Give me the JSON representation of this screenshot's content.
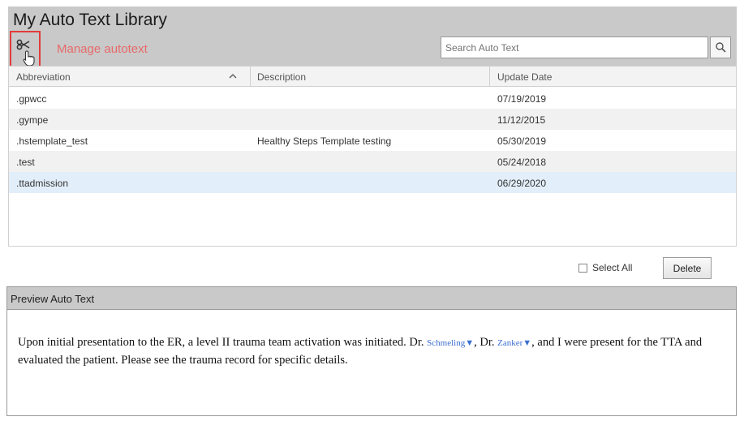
{
  "header": {
    "title": "My Auto Text Library",
    "manage_label": "Manage autotext",
    "search_placeholder": "Search Auto Text"
  },
  "table": {
    "columns": [
      "Abbreviation",
      "Description",
      "Update Date"
    ],
    "rows": [
      {
        "abbreviation": ".gpwcc",
        "description": "",
        "date": "07/19/2019"
      },
      {
        "abbreviation": ".gympe",
        "description": "",
        "date": "11/12/2015"
      },
      {
        "abbreviation": ".hstemplate_test",
        "description": "Healthy Steps Template testing",
        "date": "05/30/2019"
      },
      {
        "abbreviation": ".test",
        "description": "",
        "date": "05/24/2018"
      },
      {
        "abbreviation": ".ttadmission",
        "description": "",
        "date": "06/29/2020"
      }
    ],
    "selected_row": 4
  },
  "actions": {
    "select_all_label": "Select All",
    "delete_label": "Delete"
  },
  "preview": {
    "title": "Preview Auto Text",
    "text_part1": "Upon initial presentation to the ER, a level II trauma team activation was initiated. Dr.",
    "doctor1": "Schmeling",
    "text_part2": ", Dr.",
    "doctor2": "Zanker",
    "text_part3": ", and I were present for the TTA and evaluated the patient. Please see the trauma record for specific details.",
    "dropdown_glyph": "▼"
  },
  "colors": {
    "header_bg": "#c9c9c9",
    "highlight_border": "#e23b3b",
    "manage_link": "#e86a6a",
    "selected_row": "#e2eef9",
    "doc_link": "#3a6fd0"
  },
  "icons": [
    "scissors-icon",
    "hand-cursor-icon",
    "search-icon",
    "sort-ascending-icon"
  ]
}
